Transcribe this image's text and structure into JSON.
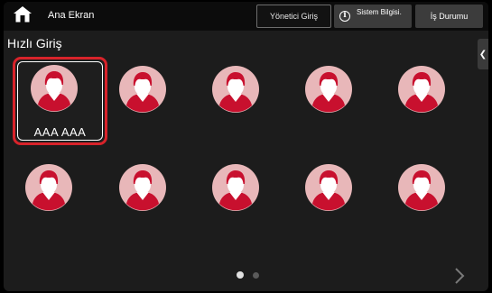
{
  "header": {
    "home_label": "Ana Ekran",
    "admin_button": "Yönetici Giriş",
    "sysinfo_button": "Sistem Bilgisi.",
    "job_status_button": "İş Durumu"
  },
  "main": {
    "section_title": "Hızlı Giriş",
    "users": [
      {
        "name": "AAA AAA",
        "selected": true
      },
      {
        "name": "",
        "selected": false
      },
      {
        "name": "",
        "selected": false
      },
      {
        "name": "",
        "selected": false
      },
      {
        "name": "",
        "selected": false
      },
      {
        "name": "",
        "selected": false
      },
      {
        "name": "",
        "selected": false
      },
      {
        "name": "",
        "selected": false
      },
      {
        "name": "",
        "selected": false
      },
      {
        "name": "",
        "selected": false
      }
    ],
    "pagination": {
      "current_page": 1,
      "total_pages": 2
    }
  },
  "icons": {
    "home": "home-icon",
    "info": "info-icon",
    "side_tab": "chevron-left-icon",
    "next": "chevron-right-icon",
    "avatar": "user-avatar-icon"
  },
  "colors": {
    "selection_border": "#d8232a",
    "avatar_background": "#e8b7b9",
    "avatar_accent": "#c8102e",
    "topbar_background": "#0c0c0c",
    "screen_background": "#1c1c1c"
  }
}
